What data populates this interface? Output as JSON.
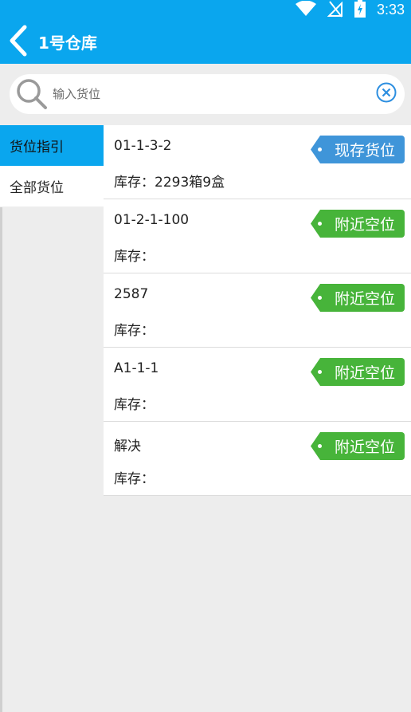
{
  "status_bar": {
    "time": "3:33",
    "icons": [
      "wifi-icon",
      "no-signal-icon",
      "battery-charging-icon"
    ]
  },
  "header": {
    "title": "1号仓库",
    "back_icon": "chevron-left-icon"
  },
  "search": {
    "placeholder": "输入货位",
    "value": "",
    "clear_icon": "clear-circle-icon"
  },
  "sidebar": {
    "items": [
      {
        "label": "货位指引",
        "active": true
      },
      {
        "label": "全部货位",
        "active": false
      }
    ]
  },
  "locations": [
    {
      "code": "01-1-3-2",
      "stock_label": "库存：",
      "stock_value": "2293箱9盒",
      "tag": "现存货位",
      "tag_color": "#3f95d9"
    },
    {
      "code": "01-2-1-100",
      "stock_label": "库存：",
      "stock_value": "",
      "tag": "附近空位",
      "tag_color": "#47b43a"
    },
    {
      "code": "2587",
      "stock_label": "库存：",
      "stock_value": "",
      "tag": "附近空位",
      "tag_color": "#47b43a"
    },
    {
      "code": "A1-1-1",
      "stock_label": "库存：",
      "stock_value": "",
      "tag": "附近空位",
      "tag_color": "#47b43a"
    },
    {
      "code": "解决",
      "stock_label": "库存：",
      "stock_value": "",
      "tag": "附近空位",
      "tag_color": "#47b43a"
    }
  ],
  "colors": {
    "primary": "#0aa6ee",
    "tag_current": "#3f95d9",
    "tag_nearby": "#47b43a",
    "background": "#ededed"
  }
}
